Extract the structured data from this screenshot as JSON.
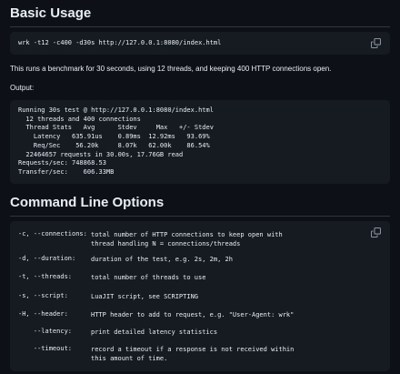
{
  "sections": {
    "basic_title": "Basic Usage",
    "cmd_title": "Command Line Options"
  },
  "basic": {
    "command": "wrk -t12 -c400 -d30s http://127.0.0.1:8080/index.html",
    "description": "This runs a benchmark for 30 seconds, using 12 threads, and keeping 400 HTTP connections open.",
    "output_label": "Output:",
    "output": "Running 30s test @ http://127.0.0.1:8080/index.html\n  12 threads and 400 connections\n  Thread Stats   Avg      Stdev     Max   +/- Stdev\n    Latency   635.91us    0.89ms  12.92ms   93.69%\n    Req/Sec    56.20k     8.07k   62.00k    86.54%\n  22464657 requests in 30.00s, 17.76GB read\nRequests/sec: 748868.53\nTransfer/sec:    606.33MB"
  },
  "options": [
    {
      "flag": "-c, --connections:",
      "desc": "total number of HTTP connections to keep open with\nthread handling N = connections/threads"
    },
    {
      "flag": "-d, --duration:",
      "desc": "duration of the test, e.g. 2s, 2m, 2h"
    },
    {
      "flag": "-t, --threads:",
      "desc": "total number of threads to use"
    },
    {
      "flag": "-s, --script:",
      "desc": "LuaJIT script, see SCRIPTING"
    },
    {
      "flag": "-H, --header:",
      "desc": "HTTP header to add to request, e.g. \"User-Agent: wrk\""
    },
    {
      "flag": "    --latency:",
      "desc": "print detailed latency statistics"
    },
    {
      "flag": "    --timeout:",
      "desc": "record a timeout if a response is not received within\nthis amount of time."
    }
  ],
  "icons": {
    "copy": "copy-icon"
  },
  "colors": {
    "background": "#0d1117",
    "code_bg": "#161b22",
    "text": "#e6edf3",
    "muted_icon": "#8b949e",
    "divider": "#30363d"
  }
}
